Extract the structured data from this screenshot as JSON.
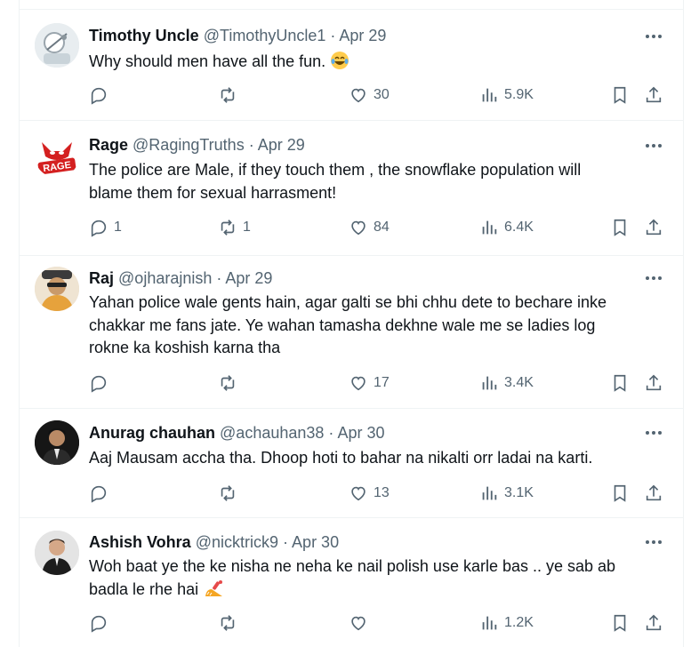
{
  "tweets": [
    {
      "name": "Timothy Uncle",
      "handle": "@TimothyUncle1",
      "date": "Apr 29",
      "text": [
        "Why should men have all the fun."
      ],
      "emoji": "laughing",
      "replies": "",
      "retweets": "",
      "likes": "30",
      "views": "5.9K",
      "more": "…"
    },
    {
      "name": "Rage",
      "handle": "@RagingTruths",
      "date": "Apr 29",
      "text": [
        "The police are Male, if they touch them , the snowflake population will",
        "blame them for sexual harrasment!"
      ],
      "replies": "1",
      "retweets": "1",
      "likes": "84",
      "views": "6.4K",
      "more": "…"
    },
    {
      "name": "Raj",
      "handle": "@ojharajnish",
      "date": "Apr 29",
      "text": [
        "Yahan police wale gents hain, agar galti se bhi chhu dete to bechare inke",
        "chakkar me fans jate. Ye wahan tamasha dekhne wale me se ladies log",
        "rokne ka koshish karna tha"
      ],
      "replies": "",
      "retweets": "",
      "likes": "17",
      "views": "3.4K",
      "more": "…"
    },
    {
      "name": "Anurag chauhan",
      "handle": "@achauhan38",
      "date": "Apr 30",
      "text": [
        "Aaj Mausam accha tha. Dhoop hoti to bahar na nikalti orr ladai na karti."
      ],
      "replies": "",
      "retweets": "",
      "likes": "13",
      "views": "3.1K",
      "more": "…"
    },
    {
      "name": "Ashish Vohra",
      "handle": "@nicktrick9",
      "date": "Apr 30",
      "text": [
        "Woh baat ye the ke nisha ne neha ke nail polish use karle bas .. ye sab ab",
        "badla le rhe hai"
      ],
      "emoji": "nail-polish",
      "replies": "",
      "retweets": "",
      "likes": "",
      "views": "1.2K",
      "more": "…"
    }
  ],
  "separator": "·",
  "colors": {
    "text": "#0f1419",
    "secondary": "#536471",
    "border": "#eff3f4"
  }
}
